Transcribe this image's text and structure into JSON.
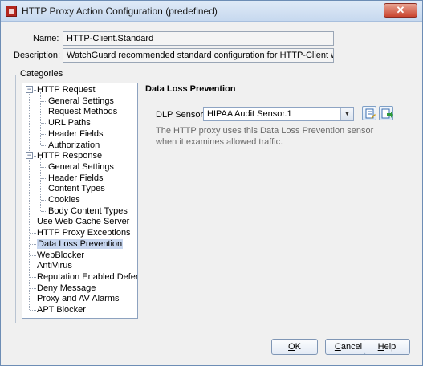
{
  "window": {
    "title": "HTTP Proxy Action Configuration (predefined)",
    "close_label": "✕"
  },
  "form": {
    "name_label": "Name:",
    "name_value": "HTTP-Client.Standard",
    "description_label": "Description:",
    "description_value": "WatchGuard recommended standard configuration for HTTP-Client with logging en"
  },
  "categories": {
    "label": "Categories",
    "tree": [
      {
        "label": "HTTP Request",
        "level": 0,
        "expander": "−"
      },
      {
        "label": "General Settings",
        "level": 1
      },
      {
        "label": "Request Methods",
        "level": 1
      },
      {
        "label": "URL Paths",
        "level": 1
      },
      {
        "label": "Header Fields",
        "level": 1
      },
      {
        "label": "Authorization",
        "level": 1
      },
      {
        "label": "HTTP Response",
        "level": 0,
        "expander": "−"
      },
      {
        "label": "General Settings",
        "level": 1
      },
      {
        "label": "Header Fields",
        "level": 1
      },
      {
        "label": "Content Types",
        "level": 1
      },
      {
        "label": "Cookies",
        "level": 1
      },
      {
        "label": "Body Content Types",
        "level": 1
      },
      {
        "label": "Use Web Cache Server",
        "level": 0
      },
      {
        "label": "HTTP Proxy Exceptions",
        "level": 0
      },
      {
        "label": "Data Loss Prevention",
        "level": 0,
        "selected": true
      },
      {
        "label": "WebBlocker",
        "level": 0
      },
      {
        "label": "AntiVirus",
        "level": 0
      },
      {
        "label": "Reputation Enabled Defense",
        "level": 0
      },
      {
        "label": "Deny Message",
        "level": 0
      },
      {
        "label": "Proxy and AV Alarms",
        "level": 0
      },
      {
        "label": "APT Blocker",
        "level": 0
      }
    ]
  },
  "dlp": {
    "section_title": "Data Loss Prevention",
    "sensor_label": "DLP Sensor:",
    "sensor_value": "HIPAA Audit Sensor.1",
    "description": "The HTTP proxy uses this Data Loss Prevention sensor when it examines allowed traffic."
  },
  "buttons": {
    "ok": "OK",
    "cancel": "Cancel",
    "help": "Help"
  },
  "colors": {
    "selection": "#c8d7f0",
    "close_button": "#c9442f"
  }
}
